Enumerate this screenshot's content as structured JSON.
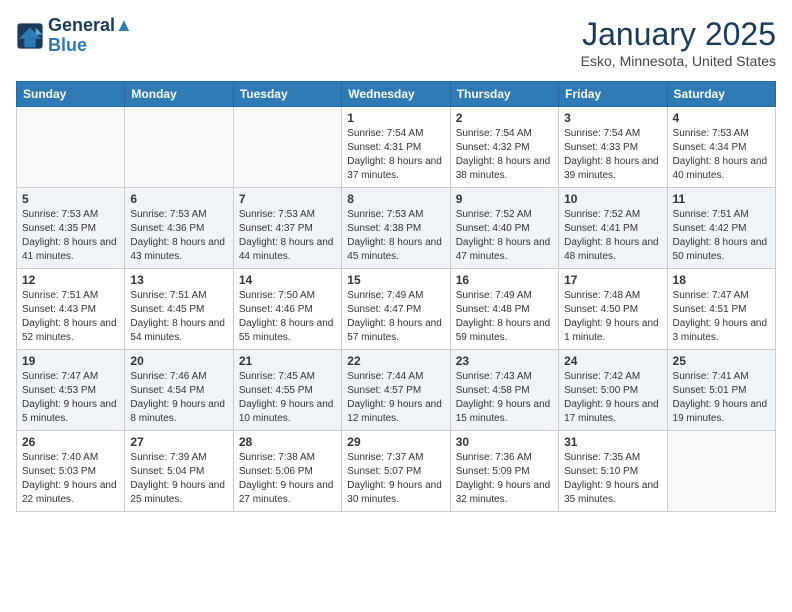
{
  "header": {
    "logo_line1": "General",
    "logo_line2": "Blue",
    "title": "January 2025",
    "subtitle": "Esko, Minnesota, United States"
  },
  "days_of_week": [
    "Sunday",
    "Monday",
    "Tuesday",
    "Wednesday",
    "Thursday",
    "Friday",
    "Saturday"
  ],
  "weeks": [
    [
      {
        "day": "",
        "info": ""
      },
      {
        "day": "",
        "info": ""
      },
      {
        "day": "",
        "info": ""
      },
      {
        "day": "1",
        "info": "Sunrise: 7:54 AM\nSunset: 4:31 PM\nDaylight: 8 hours and 37 minutes."
      },
      {
        "day": "2",
        "info": "Sunrise: 7:54 AM\nSunset: 4:32 PM\nDaylight: 8 hours and 38 minutes."
      },
      {
        "day": "3",
        "info": "Sunrise: 7:54 AM\nSunset: 4:33 PM\nDaylight: 8 hours and 39 minutes."
      },
      {
        "day": "4",
        "info": "Sunrise: 7:53 AM\nSunset: 4:34 PM\nDaylight: 8 hours and 40 minutes."
      }
    ],
    [
      {
        "day": "5",
        "info": "Sunrise: 7:53 AM\nSunset: 4:35 PM\nDaylight: 8 hours and 41 minutes."
      },
      {
        "day": "6",
        "info": "Sunrise: 7:53 AM\nSunset: 4:36 PM\nDaylight: 8 hours and 43 minutes."
      },
      {
        "day": "7",
        "info": "Sunrise: 7:53 AM\nSunset: 4:37 PM\nDaylight: 8 hours and 44 minutes."
      },
      {
        "day": "8",
        "info": "Sunrise: 7:53 AM\nSunset: 4:38 PM\nDaylight: 8 hours and 45 minutes."
      },
      {
        "day": "9",
        "info": "Sunrise: 7:52 AM\nSunset: 4:40 PM\nDaylight: 8 hours and 47 minutes."
      },
      {
        "day": "10",
        "info": "Sunrise: 7:52 AM\nSunset: 4:41 PM\nDaylight: 8 hours and 48 minutes."
      },
      {
        "day": "11",
        "info": "Sunrise: 7:51 AM\nSunset: 4:42 PM\nDaylight: 8 hours and 50 minutes."
      }
    ],
    [
      {
        "day": "12",
        "info": "Sunrise: 7:51 AM\nSunset: 4:43 PM\nDaylight: 8 hours and 52 minutes."
      },
      {
        "day": "13",
        "info": "Sunrise: 7:51 AM\nSunset: 4:45 PM\nDaylight: 8 hours and 54 minutes."
      },
      {
        "day": "14",
        "info": "Sunrise: 7:50 AM\nSunset: 4:46 PM\nDaylight: 8 hours and 55 minutes."
      },
      {
        "day": "15",
        "info": "Sunrise: 7:49 AM\nSunset: 4:47 PM\nDaylight: 8 hours and 57 minutes."
      },
      {
        "day": "16",
        "info": "Sunrise: 7:49 AM\nSunset: 4:48 PM\nDaylight: 8 hours and 59 minutes."
      },
      {
        "day": "17",
        "info": "Sunrise: 7:48 AM\nSunset: 4:50 PM\nDaylight: 9 hours and 1 minute."
      },
      {
        "day": "18",
        "info": "Sunrise: 7:47 AM\nSunset: 4:51 PM\nDaylight: 9 hours and 3 minutes."
      }
    ],
    [
      {
        "day": "19",
        "info": "Sunrise: 7:47 AM\nSunset: 4:53 PM\nDaylight: 9 hours and 5 minutes."
      },
      {
        "day": "20",
        "info": "Sunrise: 7:46 AM\nSunset: 4:54 PM\nDaylight: 9 hours and 8 minutes."
      },
      {
        "day": "21",
        "info": "Sunrise: 7:45 AM\nSunset: 4:55 PM\nDaylight: 9 hours and 10 minutes."
      },
      {
        "day": "22",
        "info": "Sunrise: 7:44 AM\nSunset: 4:57 PM\nDaylight: 9 hours and 12 minutes."
      },
      {
        "day": "23",
        "info": "Sunrise: 7:43 AM\nSunset: 4:58 PM\nDaylight: 9 hours and 15 minutes."
      },
      {
        "day": "24",
        "info": "Sunrise: 7:42 AM\nSunset: 5:00 PM\nDaylight: 9 hours and 17 minutes."
      },
      {
        "day": "25",
        "info": "Sunrise: 7:41 AM\nSunset: 5:01 PM\nDaylight: 9 hours and 19 minutes."
      }
    ],
    [
      {
        "day": "26",
        "info": "Sunrise: 7:40 AM\nSunset: 5:03 PM\nDaylight: 9 hours and 22 minutes."
      },
      {
        "day": "27",
        "info": "Sunrise: 7:39 AM\nSunset: 5:04 PM\nDaylight: 9 hours and 25 minutes."
      },
      {
        "day": "28",
        "info": "Sunrise: 7:38 AM\nSunset: 5:06 PM\nDaylight: 9 hours and 27 minutes."
      },
      {
        "day": "29",
        "info": "Sunrise: 7:37 AM\nSunset: 5:07 PM\nDaylight: 9 hours and 30 minutes."
      },
      {
        "day": "30",
        "info": "Sunrise: 7:36 AM\nSunset: 5:09 PM\nDaylight: 9 hours and 32 minutes."
      },
      {
        "day": "31",
        "info": "Sunrise: 7:35 AM\nSunset: 5:10 PM\nDaylight: 9 hours and 35 minutes."
      },
      {
        "day": "",
        "info": ""
      }
    ]
  ]
}
